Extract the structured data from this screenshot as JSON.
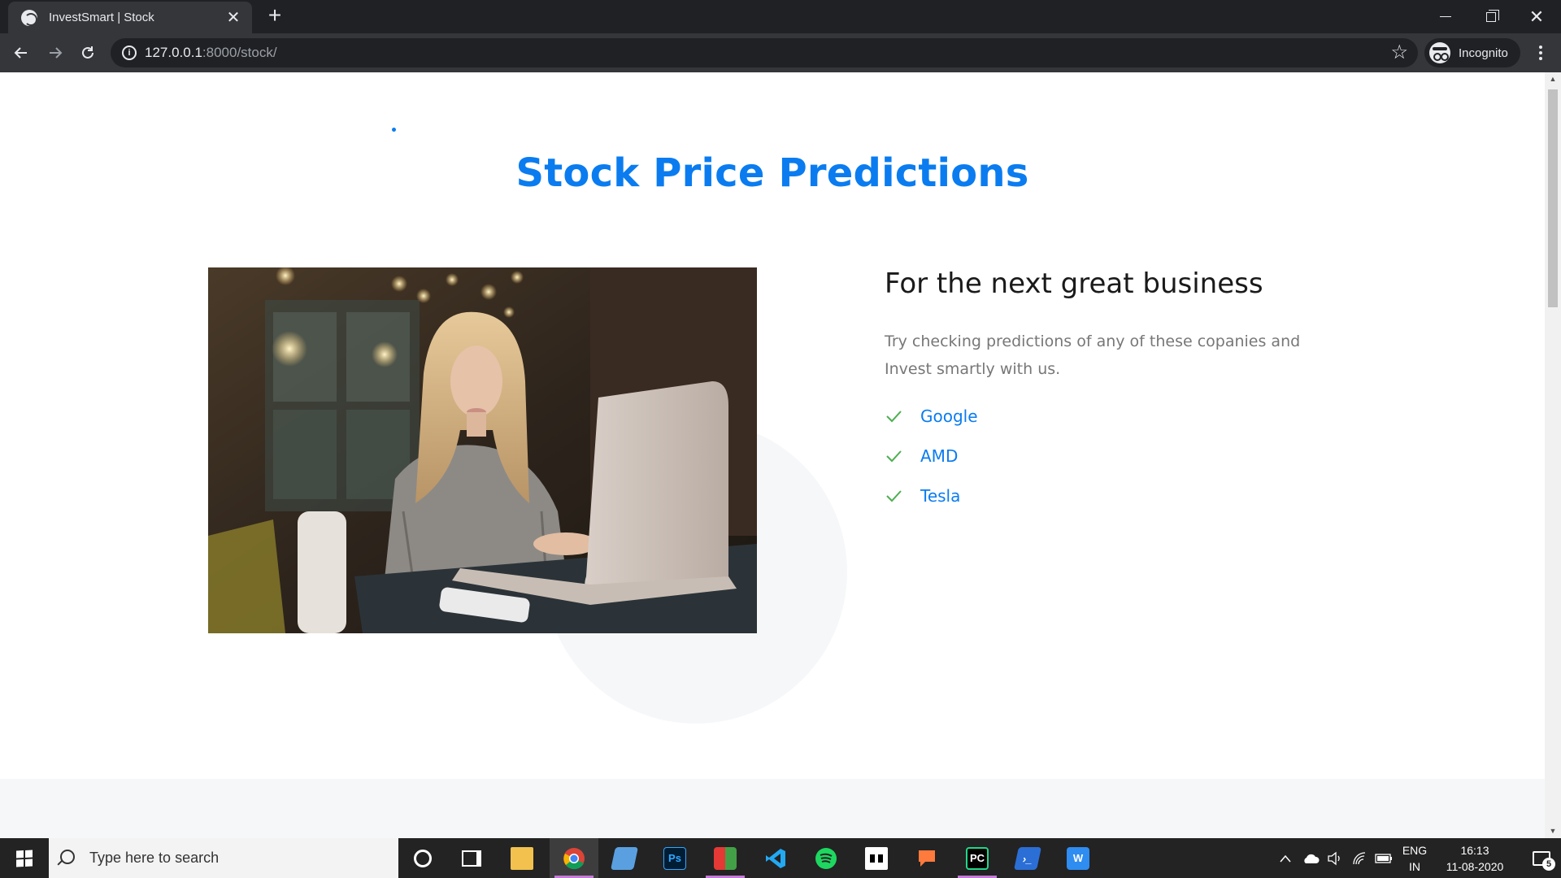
{
  "browser": {
    "tab_title": "InvestSmart | Stock",
    "url_host": "127.0.0.1",
    "url_path": ":8000/stock/",
    "profile_label": "Incognito"
  },
  "page": {
    "title": "Stock Price Predictions",
    "section_heading": "For the next great business",
    "section_text": "Try checking predictions of any of these copanies and Invest smartly with us.",
    "companies": [
      {
        "name": "Google"
      },
      {
        "name": "AMD"
      },
      {
        "name": "Tesla"
      }
    ],
    "colors": {
      "accent": "#0a7cf0",
      "check": "#4caf50"
    },
    "image_description_icon": "woman-with-laptop-photo"
  },
  "taskbar": {
    "search_placeholder": "Type here to search",
    "language_top": "ENG",
    "language_bottom": "IN",
    "time": "16:13",
    "date": "11-08-2020",
    "notification_count": "5",
    "apps": [
      {
        "name": "cortana-icon"
      },
      {
        "name": "task-view-icon"
      },
      {
        "name": "file-explorer-icon"
      },
      {
        "name": "chrome-icon"
      },
      {
        "name": "app-icon"
      },
      {
        "name": "photoshop-icon",
        "label": "Ps"
      },
      {
        "name": "app-icon"
      },
      {
        "name": "vscode-icon"
      },
      {
        "name": "spotify-icon"
      },
      {
        "name": "app-icon"
      },
      {
        "name": "app-icon"
      },
      {
        "name": "pycharm-icon",
        "label": "PC"
      },
      {
        "name": "powershell-icon"
      },
      {
        "name": "wps-writer-icon",
        "label": "W"
      }
    ]
  }
}
